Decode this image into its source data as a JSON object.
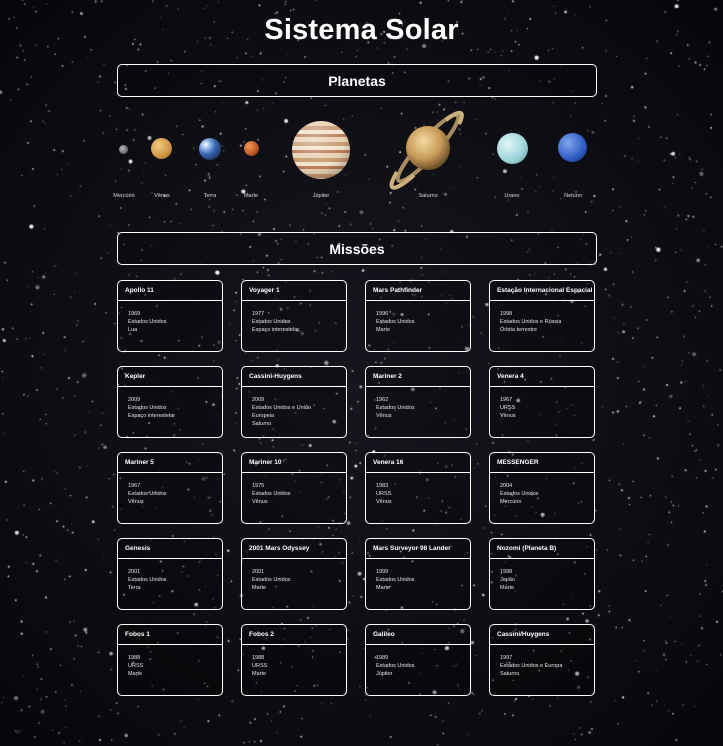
{
  "title": "Sistema Solar",
  "planets_heading": "Planetas",
  "missions_heading": "Missões",
  "planets": [
    {
      "label": "Mercúrio",
      "icon": "mercury-planet-icon",
      "color": "#8a8690"
    },
    {
      "label": "Vênus",
      "icon": "venus-planet-icon",
      "color": "#d9a45a"
    },
    {
      "label": "Terra",
      "icon": "earth-planet-icon",
      "color": "#4a76b8"
    },
    {
      "label": "Marte",
      "icon": "mars-planet-icon",
      "color": "#c4622f"
    },
    {
      "label": "Júpiter",
      "icon": "jupiter-planet-icon",
      "color": "#d9b48e"
    },
    {
      "label": "Saturno",
      "icon": "saturn-planet-icon",
      "color": "#d6b77c"
    },
    {
      "label": "Urano",
      "icon": "uranus-planet-icon",
      "color": "#a9dde0"
    },
    {
      "label": "Netuno",
      "icon": "neptune-planet-icon",
      "color": "#3b67c9"
    }
  ],
  "missions": [
    {
      "name": "Apollo 11",
      "year": "1969",
      "country": "Estados Unidos",
      "target": "Lua"
    },
    {
      "name": "Voyager 1",
      "year": "1977",
      "country": "Estados Unidos",
      "target": "Espaço interestelar"
    },
    {
      "name": "Mars Pathfinder",
      "year": "1996",
      "country": "Estados Unidos",
      "target": "Marte"
    },
    {
      "name": "Estação Internacional Espacial",
      "year": "1998",
      "country": "Estados Unidos e Rússia",
      "target": "Órbita terrestre"
    },
    {
      "name": "Kepler",
      "year": "2009",
      "country": "Estados Unidos",
      "target": "Espaço interestelar"
    },
    {
      "name": "Cassini-Huygens",
      "year": "2009",
      "country": "Estados Unidos e União",
      "target": "Europeia",
      "extra": "Saturno"
    },
    {
      "name": "Mariner 2",
      "year": "1962",
      "country": "Estados Unidos",
      "target": "Vênus"
    },
    {
      "name": "Venera 4",
      "year": "1967",
      "country": "URSS",
      "target": "Vênus"
    },
    {
      "name": "Mariner 5",
      "year": "1967",
      "country": "Estados Unidos",
      "target": "Vênus"
    },
    {
      "name": "Mariner 10",
      "year": "1975",
      "country": "Estados Unidos",
      "target": "Vênus"
    },
    {
      "name": "Venera 16",
      "year": "1983",
      "country": "URSS",
      "target": "Vênus"
    },
    {
      "name": "MESSENGER",
      "year": "2004",
      "country": "Estados Unidos",
      "target": "Mercúrio"
    },
    {
      "name": "Genesis",
      "year": "2001",
      "country": "Estados Unidos",
      "target": "Terra"
    },
    {
      "name": "2001 Mars Odyssey",
      "year": "2001",
      "country": "Estados Unidos",
      "target": "Marte"
    },
    {
      "name": "Mars Surveyor 98 Lander",
      "year": "1999",
      "country": "Estados Unidos",
      "target": "Marte"
    },
    {
      "name": "Nozomi (Planeta B)",
      "year": "1998",
      "country": "Japão",
      "target": "Marte"
    },
    {
      "name": "Fobos 1",
      "year": "1988",
      "country": "URSS",
      "target": "Marte"
    },
    {
      "name": "Fobos 2",
      "year": "1988",
      "country": "URSS",
      "target": "Marte"
    },
    {
      "name": "Galileo",
      "year": "1989",
      "country": "Estados Unidos",
      "target": "Júpiter"
    },
    {
      "name": "Cassini/Huygens",
      "year": "1997",
      "country": "Estados Unidos e Europa",
      "target": "Saturno"
    }
  ]
}
